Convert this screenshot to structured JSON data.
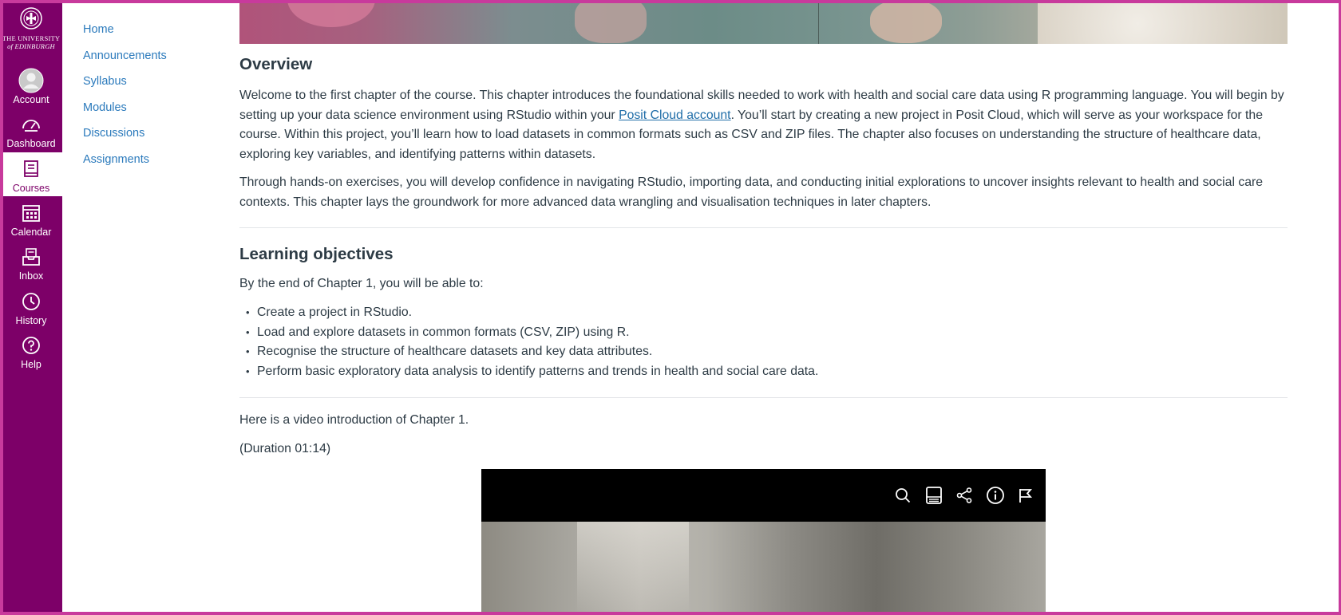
{
  "brand": {
    "university_line1": "THE UNIVERSITY",
    "university_line2": "of EDINBURGH",
    "nav_color": "#7d0068"
  },
  "global_nav": [
    {
      "label": "Account",
      "icon": "account-icon"
    },
    {
      "label": "Dashboard",
      "icon": "dashboard-icon"
    },
    {
      "label": "Courses",
      "icon": "courses-icon",
      "active": true
    },
    {
      "label": "Calendar",
      "icon": "calendar-icon"
    },
    {
      "label": "Inbox",
      "icon": "inbox-icon"
    },
    {
      "label": "History",
      "icon": "history-icon"
    },
    {
      "label": "Help",
      "icon": "help-icon"
    }
  ],
  "course_nav": [
    "Home",
    "Announcements",
    "Syllabus",
    "Modules",
    "Discussions",
    "Assignments"
  ],
  "overview": {
    "heading": "Overview",
    "p1_before": "Welcome to the first chapter of the course. This chapter introduces the foundational skills needed to work with health and social care data using R programming language. You will begin by setting up your data science environment using RStudio within your ",
    "p1_link": "Posit Cloud account",
    "p1_after": ". You’ll start by creating a new project in Posit Cloud, which will serve as your workspace for the course. Within this project, you’ll learn how to load datasets in common formats such as CSV and ZIP files. The chapter also focuses on understanding the structure of healthcare data, exploring key variables, and identifying patterns within datasets.",
    "p2": "Through hands-on exercises, you will develop confidence in navigating RStudio, importing data, and conducting initial explorations to uncover insights relevant to health and social care contexts. This chapter lays the groundwork for more advanced data wrangling and visualisation techniques in later chapters."
  },
  "learning_objectives": {
    "heading": "Learning objectives",
    "intro": "By the end of Chapter 1, you will be able to:",
    "items": [
      "Create a project in RStudio.",
      "Load and explore datasets in common formats (CSV, ZIP) using R.",
      "Recognise the structure of healthcare datasets and key data attributes.",
      "Perform basic exploratory data analysis to identify patterns and trends in health and social care data."
    ]
  },
  "video": {
    "intro": "Here is a video introduction of Chapter 1.",
    "duration": "(Duration 01:14)",
    "controls": [
      "search-icon",
      "captions-icon",
      "share-icon",
      "info-icon",
      "flag-icon"
    ]
  }
}
